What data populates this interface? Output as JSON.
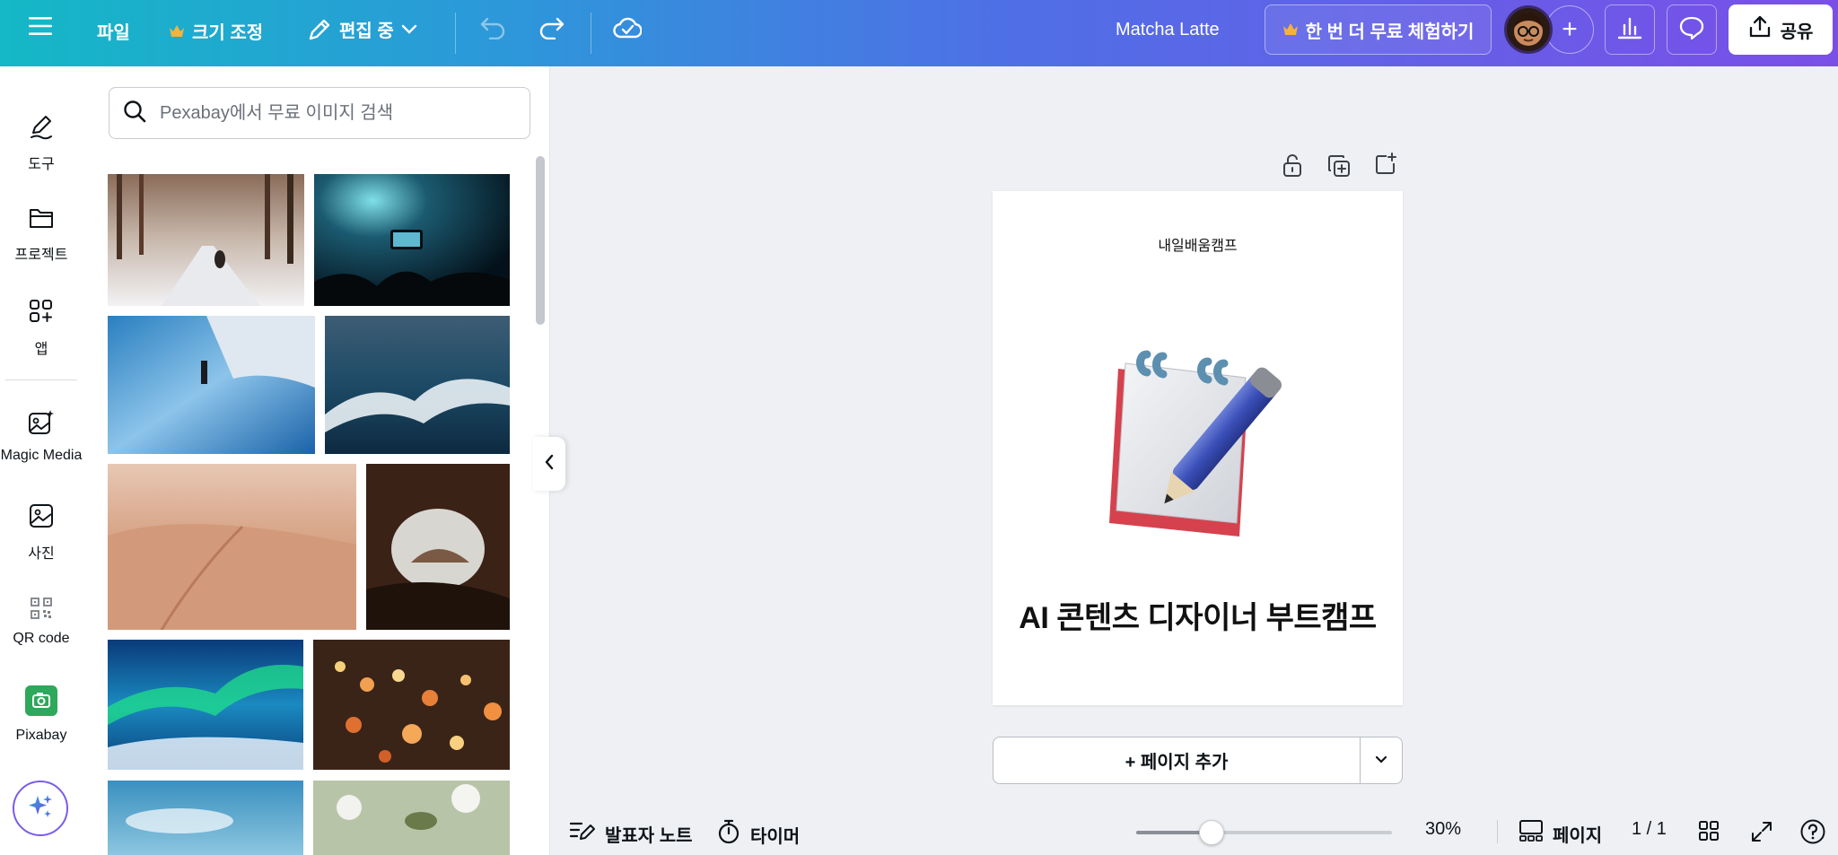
{
  "topbar": {
    "menu_icon": "hamburger-icon",
    "file_label": "파일",
    "resize_label": "크기 조정",
    "editing_label": "편집 중",
    "doc_title": "Matcha Latte",
    "trial_label": "한 번 더 무료 체험하기",
    "share_label": "공유",
    "colors": {
      "crown": "#f5b33a",
      "gradient_start": "#14b8c6",
      "gradient_end": "#7a4fe8"
    }
  },
  "rail": {
    "items": [
      {
        "label": "도구",
        "icon": "pen-tool-icon"
      },
      {
        "label": "프로젝트",
        "icon": "folder-icon"
      },
      {
        "label": "앱",
        "icon": "apps-grid-icon"
      },
      {
        "label": "Magic Media",
        "icon": "magic-media-icon"
      },
      {
        "label": "사진",
        "icon": "photo-icon"
      },
      {
        "label": "QR code",
        "icon": "qr-code-icon"
      },
      {
        "label": "Pixabay",
        "icon": "pixabay-icon"
      }
    ]
  },
  "panel": {
    "search_placeholder": "Pexabay에서 무료 이미지 검색"
  },
  "canvas": {
    "subtitle": "내일배움캠프",
    "title": "AI 콘텐츠 디자이너 부트캠프",
    "add_page_label": "+ 페이지 추가"
  },
  "bottombar": {
    "notes_label": "발표자 노트",
    "timer_label": "타이머",
    "zoom": "30%",
    "zoom_level": 0.3,
    "pages_label": "페이지",
    "page_count": "1 / 1"
  }
}
